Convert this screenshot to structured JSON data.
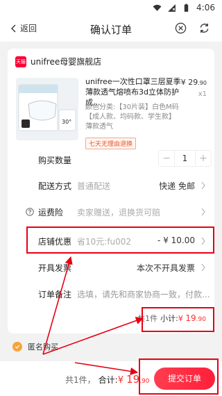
{
  "status": {
    "time": "4:06"
  },
  "nav": {
    "back_label": "返回",
    "title": "确认订单"
  },
  "shop": {
    "badge": "天猫",
    "name": "unifree母婴旗舰店"
  },
  "product": {
    "title": "unifree一次性口罩三层夏季薄款透气熔喷布3d立体防护成...",
    "price_main": "¥ 29",
    "price_decimal": ".90",
    "qty": "x1",
    "sku": "颜色分类:【30片装】白色M码【成人款、均码款、学生款】薄款透气",
    "service": "七天无理由退换",
    "image_text": "30°"
  },
  "rows": {
    "quantity": {
      "label": "购买数量",
      "value": "1",
      "minus": "−",
      "plus": "+"
    },
    "delivery": {
      "label": "配送方式",
      "hint": "普通配送",
      "value": "快递 免邮"
    },
    "freight": {
      "label": "运费险",
      "hint": "卖家赠送，退换货可赔"
    },
    "discount": {
      "label": "店铺优惠",
      "hint": "省10元:fu002",
      "value": "- ¥ 10.00"
    },
    "invoice": {
      "label": "开具发票",
      "value": "本次不开具发票"
    },
    "remark": {
      "label": "订单备注",
      "placeholder": "选填，请先和商家协商一致，付款..."
    }
  },
  "subtotal": {
    "count": "共1件",
    "label": "小计:",
    "currency": "¥ ",
    "amount": "19",
    "decimal": ".90"
  },
  "anonymous": {
    "label": "匿名购买"
  },
  "footer": {
    "count": "共1件，",
    "label": "合计:",
    "currency": "¥ ",
    "amount": "19",
    "decimal": ".90",
    "submit": "提交订单"
  },
  "colors": {
    "accent": "#ff2c2c",
    "highlight": "#e60012",
    "tmall": "#ff0036"
  }
}
